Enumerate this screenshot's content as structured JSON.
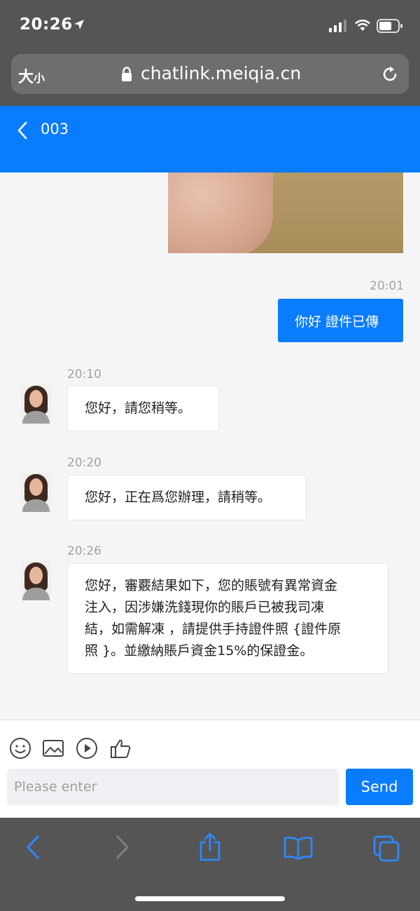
{
  "status_bar": {
    "time": "20:26"
  },
  "browser": {
    "text_size_label": "大",
    "text_size_small": "小",
    "url": "chatlink.meiqia.cn"
  },
  "header": {
    "title": "003"
  },
  "messages": [
    {
      "from": "customer",
      "time": "20:01",
      "text": "你好 證件已傳"
    },
    {
      "from": "agent",
      "time": "20:10",
      "text": "您好，請您稍等。"
    },
    {
      "from": "agent",
      "time": "20:20",
      "text": "您好，正在爲您辦理，請稍等。"
    },
    {
      "from": "agent",
      "time": "20:26",
      "lines": [
        "您好，審覈結果如下，您的賬號有異常資金",
        "注入，因涉嫌洗錢現你的賬戶已被我司凍",
        "結，如需解凍 ，請提供手持證件照 {證件原",
        "照 }。並繳納賬戶資金15%的保證金。"
      ]
    }
  ],
  "composer": {
    "placeholder": "Please enter",
    "send_label": "Send",
    "tools": [
      "emoji-icon",
      "image-icon",
      "video-icon",
      "thumbs-up-icon"
    ]
  },
  "toolbar": {
    "icons": [
      "back-icon",
      "forward-icon",
      "share-icon",
      "bookmarks-icon",
      "tabs-icon"
    ]
  },
  "colors": {
    "accent": "#0a7cff",
    "chrome": "#555555",
    "chat_background": "#f5f5f7",
    "timestamp": "#a3a3a3"
  }
}
